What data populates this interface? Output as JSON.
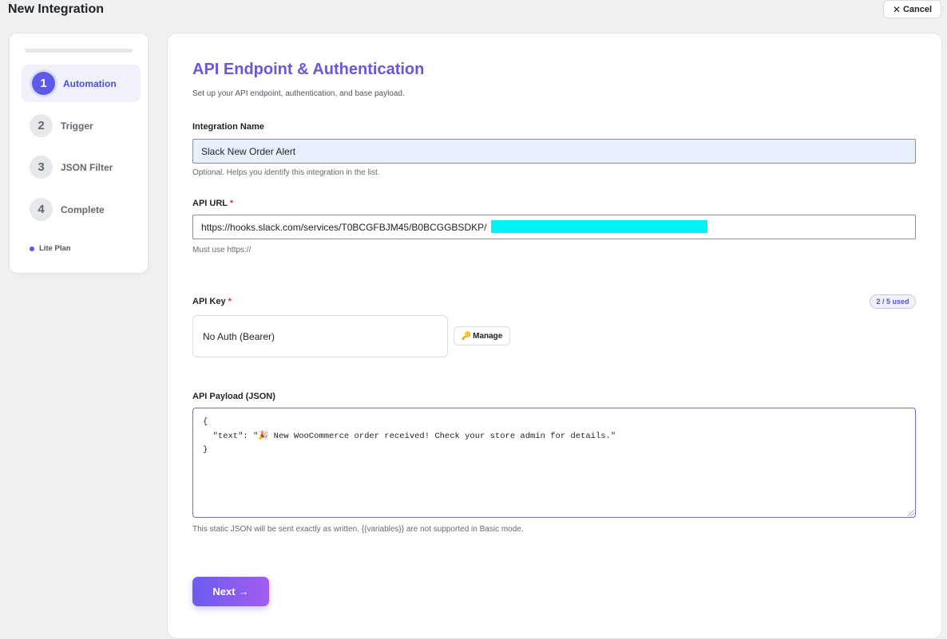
{
  "header": {
    "title": "New Integration",
    "cancel_label": "Cancel"
  },
  "sidebar": {
    "steps": [
      {
        "num": "1",
        "label": "Automation",
        "active": true
      },
      {
        "num": "2",
        "label": "Trigger",
        "active": false
      },
      {
        "num": "3",
        "label": "JSON Filter",
        "active": false
      },
      {
        "num": "4",
        "label": "Complete",
        "active": false
      }
    ],
    "plan": "Lite Plan"
  },
  "main": {
    "title": "API Endpoint & Authentication",
    "subtitle": "Set up your API endpoint, authentication, and base payload.",
    "name_field": {
      "label": "Integration Name",
      "value": "Slack New Order Alert",
      "help": "Optional. Helps you identify this integration in the list."
    },
    "url_field": {
      "label": "API URL",
      "required_mark": "*",
      "value": "https://hooks.slack.com/services/T0BCGFBJM45/B0BCGGBSDKP/",
      "help": "Must use https://"
    },
    "key_field": {
      "label": "API Key",
      "required_mark": "*",
      "usage": "2 / 5 used",
      "selected": "No Auth (Bearer)",
      "manage_label": "Manage"
    },
    "payload_field": {
      "label": "API Payload (JSON)",
      "value": "{\n  \"text\": \"🎉 New WooCommerce order received! Check your store admin for details.\"\n}",
      "help": "This static JSON will be sent exactly as written. {{variables}} are not supported in Basic mode."
    },
    "next_label": "Next",
    "next_arrow": "→"
  },
  "colors": {
    "accent": "#5b5be8",
    "title": "#6c55e0",
    "redaction": "#00f2f7"
  }
}
